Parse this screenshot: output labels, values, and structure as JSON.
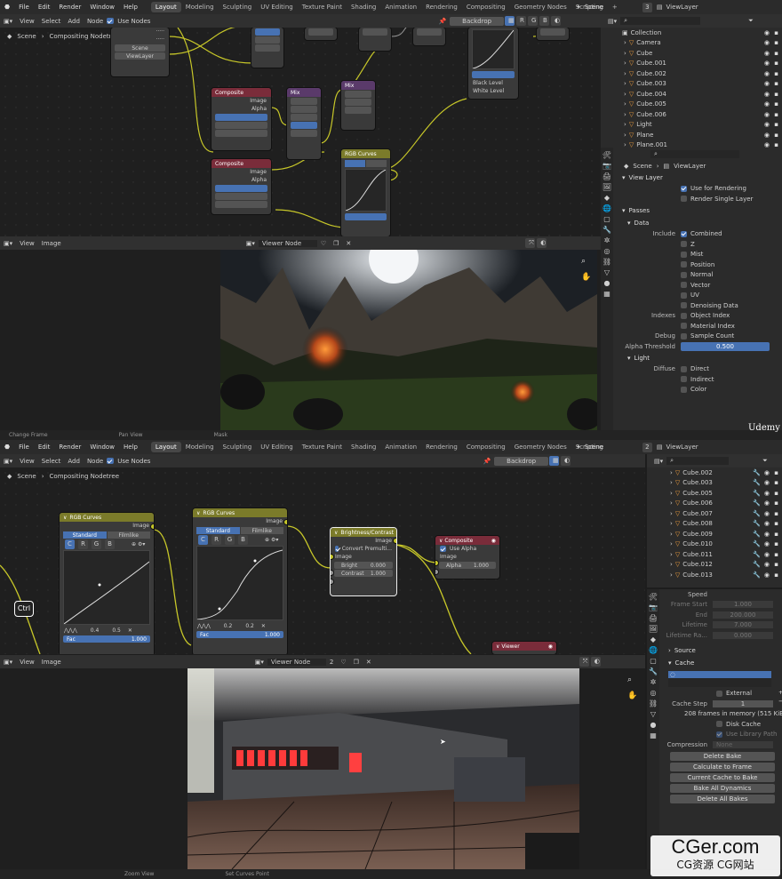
{
  "top": {
    "menu": [
      "File",
      "Edit",
      "Render",
      "Window",
      "Help"
    ],
    "tabs": [
      "Layout",
      "Modeling",
      "Sculpting",
      "UV Editing",
      "Texture Paint",
      "Shading",
      "Animation",
      "Rendering",
      "Compositing",
      "Geometry Nodes",
      "Scripting"
    ],
    "plus": "+",
    "scene": "Scene",
    "scene_count": "3",
    "viewlayer": "ViewLayer",
    "node_header": {
      "view": "View",
      "select": "Select",
      "add": "Add",
      "node": "Node",
      "use_nodes": "Use Nodes",
      "backdrop": "Backdrop",
      "channels": [
        "R",
        "G",
        "B"
      ]
    },
    "breadcrumb": {
      "scene": "Scene",
      "tree": "Compositing Nodetree"
    },
    "image_header": {
      "view": "View",
      "image": "Image",
      "viewer": "Viewer Node"
    },
    "outliner": {
      "collection": "Collection",
      "items": [
        "Camera",
        "Cube",
        "Cube.001",
        "Cube.002",
        "Cube.003",
        "Cube.004",
        "Cube.005",
        "Cube.006",
        "Light",
        "Plane",
        "Plane.001"
      ]
    },
    "properties": {
      "scene": "Scene",
      "viewlayer": "ViewLayer",
      "view_layer": "View Layer",
      "use_for_rendering": "Use for Rendering",
      "render_single_layer": "Render Single Layer",
      "passes": "Passes",
      "data": "Data",
      "include": "Include",
      "include_items": [
        "Combined",
        "Z",
        "Mist",
        "Position",
        "Normal",
        "Vector",
        "UV",
        "Denoising Data"
      ],
      "indexes": "Indexes",
      "object_index": "Object Index",
      "material_index": "Material Index",
      "debug": "Debug",
      "sample_count": "Sample Count",
      "alpha_threshold": "Alpha Threshold",
      "alpha_value": "0.500",
      "light": "Light",
      "diffuse": "Diffuse",
      "direct": "Direct",
      "indirect": "Indirect",
      "color": "Color"
    },
    "status": [
      "Change Frame",
      "Pan View",
      "Mask"
    ],
    "nodes_small": {
      "scene": "Scene",
      "render_layer": "ViewLayer",
      "n1": "Composite",
      "n2": "Composite",
      "n3": "Mix",
      "n4": "Mix",
      "n5": "RGB Curves",
      "image": "Image",
      "alpha": "Alpha"
    }
  },
  "bottom": {
    "menu": [
      "File",
      "Edit",
      "Render",
      "Window",
      "Help"
    ],
    "tabs": [
      "Layout",
      "Modeling",
      "Sculpting",
      "UV Editing",
      "Texture Paint",
      "Shading",
      "Animation",
      "Rendering",
      "Compositing",
      "Geometry Nodes",
      "Scripting"
    ],
    "scene": "Scene",
    "scene_count": "2",
    "viewlayer": "ViewLayer",
    "node_header": {
      "view": "View",
      "select": "Select",
      "add": "Add",
      "node": "Node",
      "use_nodes": "Use Nodes",
      "backdrop": "Backdrop"
    },
    "breadcrumb": {
      "scene": "Scene",
      "tree": "Compositing Nodetree"
    },
    "ctrl": "Ctrl",
    "rgb1": {
      "title": "RGB Curves",
      "out": "Image",
      "std": "Standard",
      "film": "Filmlike",
      "ch": [
        "C",
        "R",
        "G",
        "B"
      ],
      "v1": "0.4",
      "v2": "0.5",
      "fac_label": "Fac",
      "fac": "1.000"
    },
    "rgb2": {
      "title": "RGB Curves",
      "out": "Image",
      "std": "Standard",
      "film": "Filmlike",
      "ch": [
        "C",
        "R",
        "G",
        "B"
      ],
      "v1": "0.2",
      "v2": "0.2",
      "fac_label": "Fac",
      "fac": "1.000"
    },
    "bc": {
      "title": "Brightness/Contrast",
      "out": "Image",
      "convert": "Convert Premulti...",
      "in": "Image",
      "bright_label": "Bright",
      "bright": "0.000",
      "contrast_label": "Contrast",
      "contrast": "1.000"
    },
    "comp": {
      "title": "Composite",
      "use_alpha": "Use Alpha",
      "image": "Image",
      "alpha_label": "Alpha",
      "alpha": "1.000"
    },
    "viewer": {
      "title": "Viewer"
    },
    "image_header": {
      "view": "View",
      "image": "Image",
      "viewer": "Viewer Node",
      "count": "2"
    },
    "outliner": [
      "Cube.002",
      "Cube.003",
      "Cube.005",
      "Cube.006",
      "Cube.007",
      "Cube.008",
      "Cube.009",
      "Cube.010",
      "Cube.011",
      "Cube.012",
      "Cube.013"
    ],
    "physics": {
      "speed": "Speed",
      "frame_start": "Frame Start",
      "frame_start_v": "1.000",
      "end": "End",
      "end_v": "200.000",
      "lifetime": "Lifetime",
      "lifetime_v": "7.000",
      "lifetime_rand": "Lifetime Ra...",
      "lifetime_rand_v": "0.000",
      "source": "Source",
      "cache": "Cache",
      "external": "External",
      "cache_step": "Cache Step",
      "cache_step_v": "1",
      "memory": "208 frames in memory (515 KiB).",
      "disk_cache": "Disk Cache",
      "use_lib_path": "Use Library Path",
      "compression": "Compression",
      "compression_v": "None",
      "buttons": [
        "Delete Bake",
        "Calculate to Frame",
        "Current Cache to Bake",
        "Bake All Dynamics",
        "Delete All Bakes"
      ]
    },
    "status": [
      "Zoom View",
      "Set Curves Point"
    ]
  },
  "watermark": {
    "udemy": "Udemy",
    "cger": "CGer.com",
    "cger_sub": "CG资源 CG网站"
  },
  "colors": {
    "accent": "#4772b3",
    "orange": "#f2a03f",
    "curve_header": "#7b7b2a",
    "composite_header": "#7a2c3a",
    "node_bg": "#3a3a3a"
  }
}
